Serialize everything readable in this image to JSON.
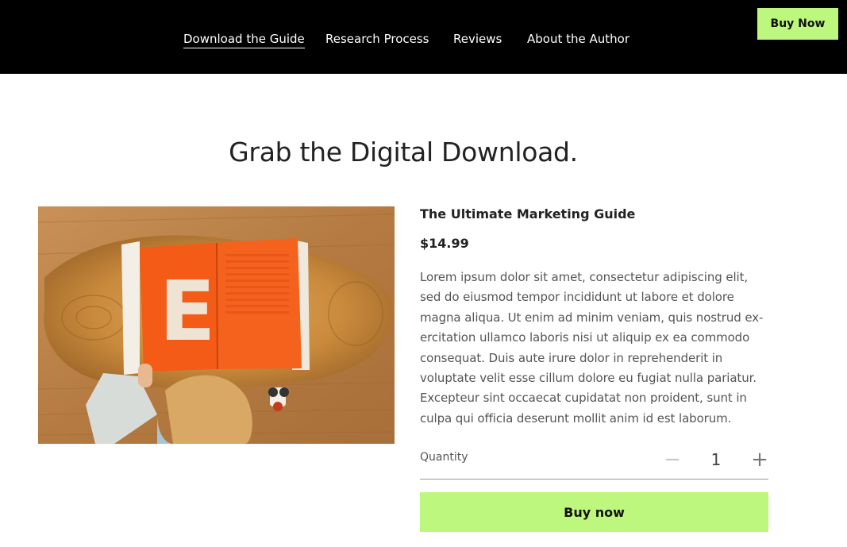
{
  "nav": {
    "items": [
      {
        "label": "Download the Guide",
        "active": true
      },
      {
        "label": "Research Process"
      },
      {
        "label": "Reviews"
      },
      {
        "label": "About the Author"
      }
    ],
    "cta_label": "Buy Now"
  },
  "main": {
    "heading": "Grab the Digital Download.",
    "product": {
      "image_icon": "book-photo",
      "book_letter": "E",
      "title": "The Ultimate Marketing Guide",
      "price": "$14.99",
      "description_lines": [
        "Lorem ipsum dolor sit amet, consectetur adipiscing elit,",
        "sed do eiusmod tempor incididunt ut labore et dolore",
        "magna aliqua. Ut enim ad minim veniam, quis nostrud ex-",
        "ercitation ullamco laboris nisi ut aliquip ex ea commodo",
        "consequat. Duis aute irure dolor in reprehenderit in",
        "voluptate velit esse cillum dolore eu fugiat nulla pariatur.",
        "Excepteur sint occaecat cupidatat non proident, sunt in",
        "culpa qui officia deserunt mollit anim id est laborum."
      ],
      "quantity_label": "Quantity",
      "quantity_value": "1",
      "decrement_symbol": "−",
      "increment_symbol": "+",
      "buy_label": "Buy now"
    }
  },
  "colors": {
    "accent": "#bdf77d",
    "header_bg": "#000000",
    "book_orange": "#f45b17"
  }
}
